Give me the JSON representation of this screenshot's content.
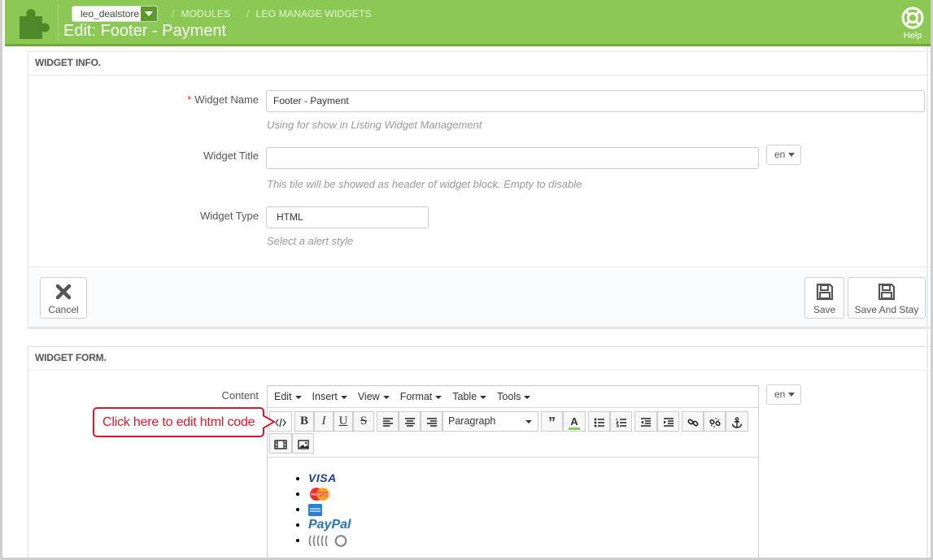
{
  "header": {
    "shop_selector": "leo_dealstore",
    "breadcrumb": [
      "MODULES",
      "LEO MANAGE WIDGETS"
    ],
    "title": "Edit: Footer - Payment",
    "help_label": "Help",
    "colors": {
      "bar": "#8bc954",
      "bar_border": "#6ea93a"
    }
  },
  "widget_info": {
    "heading": "WIDGET INFO.",
    "name_label": "Widget Name",
    "required_mark": "*",
    "name_value": "Footer - Payment",
    "name_hint": "Using for show in Listing Widget Management",
    "title_label": "Widget Title",
    "title_value": "",
    "title_lang": "en",
    "title_hint": "This tile will be showed as header of widget block. Empty to disable",
    "type_label": "Widget Type",
    "type_value": "HTML",
    "type_hint": "Select a alert style",
    "cancel_label": "Cancel",
    "save_label": "Save",
    "save_stay_label": "Save And Stay"
  },
  "widget_form": {
    "heading": "WIDGET FORM.",
    "content_label": "Content",
    "content_lang": "en",
    "menus": [
      "Edit",
      "Insert",
      "View",
      "Format",
      "Table",
      "Tools"
    ],
    "format_select": "Paragraph",
    "payment_items": [
      {
        "icon": "visa-logo",
        "text": "VISA",
        "color": "#1a3d8f"
      },
      {
        "icon": "mastercard-logo",
        "text": "MasterCard",
        "color": "#e8312f"
      },
      {
        "icon": "amex-logo",
        "text": "",
        "color": "#2f7fd0"
      },
      {
        "icon": "paypal-logo",
        "text": "PayPal",
        "color": "#2a72b8"
      },
      {
        "icon": "contactless-logo",
        "text": "",
        "color": "#888888"
      }
    ]
  },
  "annotation": {
    "callout_text": "Click here to edit html code",
    "color": "#d7192c"
  }
}
